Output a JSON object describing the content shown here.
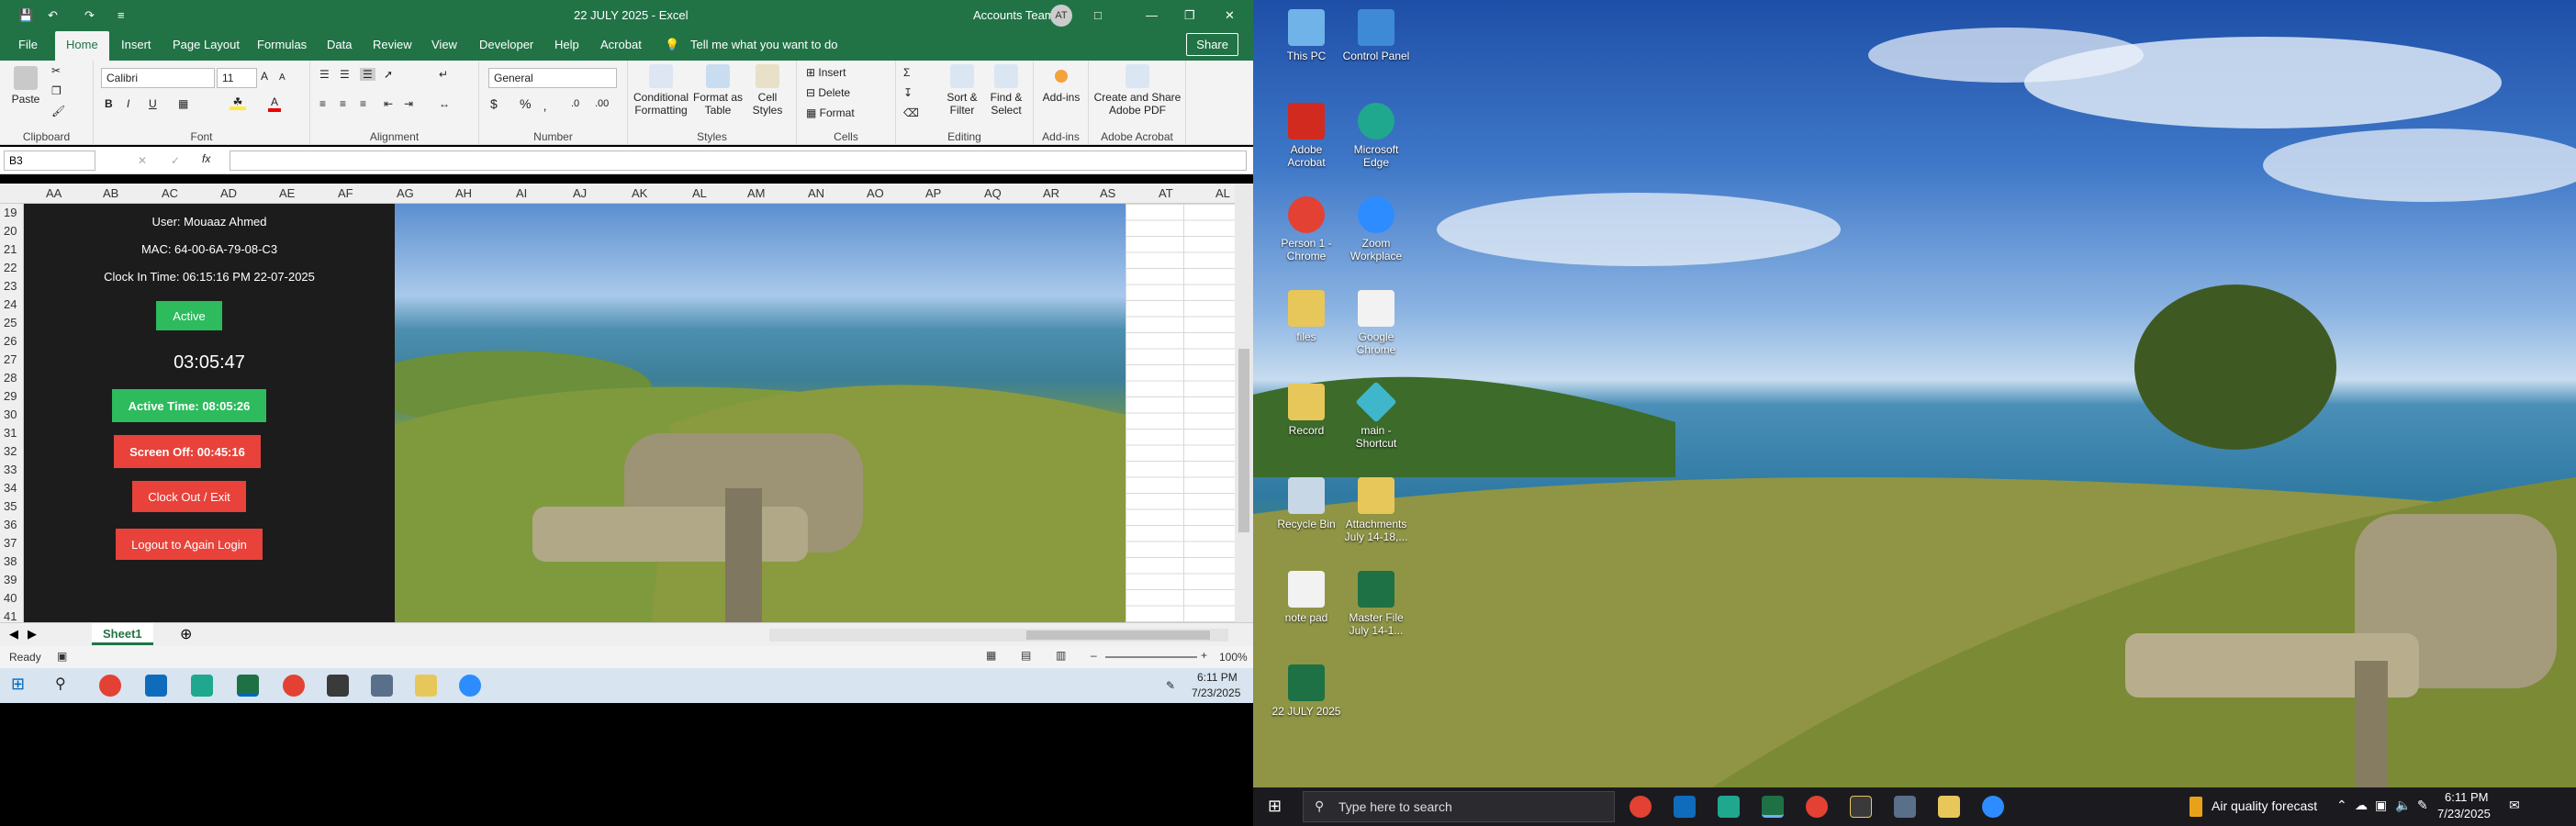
{
  "excel": {
    "titlebar": {
      "doc_title": "22 JULY 2025 - Excel",
      "account": "Accounts Team",
      "avatar": "AT"
    },
    "tabs": [
      "File",
      "Home",
      "Insert",
      "Page Layout",
      "Formulas",
      "Data",
      "Review",
      "View",
      "Developer",
      "Help",
      "Acrobat"
    ],
    "tell_me": "Tell me what you want to do",
    "share": "Share",
    "ribbon": {
      "clipboard": {
        "paste": "Paste",
        "label": "Clipboard"
      },
      "font": {
        "name": "Calibri",
        "size": "11",
        "label": "Font"
      },
      "alignment": {
        "label": "Alignment"
      },
      "number": {
        "format": "General",
        "label": "Number"
      },
      "styles": {
        "conditional": "Conditional Formatting",
        "format_table": "Format as Table",
        "cell_styles": "Cell Styles",
        "label": "Styles"
      },
      "cells": {
        "insert": "Insert",
        "delete": "Delete",
        "format": "Format",
        "label": "Cells"
      },
      "editing": {
        "sort": "Sort & Filter",
        "find": "Find & Select",
        "label": "Editing"
      },
      "addins": {
        "btn": "Add-ins",
        "label": "Add-ins"
      },
      "acrobat": {
        "btn": "Create and Share Adobe PDF",
        "label": "Adobe Acrobat"
      }
    },
    "name_box": "B3",
    "columns": [
      "AA",
      "AB",
      "AC",
      "AD",
      "AE",
      "AF",
      "AG",
      "AH",
      "AI",
      "AJ",
      "AK",
      "AL",
      "AM",
      "AN",
      "AO",
      "AP",
      "AQ",
      "AR",
      "AS",
      "AT",
      "AL"
    ],
    "rows": [
      "19",
      "20",
      "21",
      "22",
      "23",
      "24",
      "25",
      "26",
      "27",
      "28",
      "29",
      "30",
      "31",
      "32",
      "33",
      "34",
      "35",
      "36",
      "37",
      "38",
      "39",
      "40",
      "41"
    ],
    "panel": {
      "user": "User: Mouaaz Ahmed",
      "mac": "MAC: 64-00-6A-79-08-C3",
      "clock_in": "Clock In Time: 06:15:16 PM 22-07-2025",
      "status": "Active",
      "timer": "03:05:47",
      "active_time": "Active Time: 08:05:26",
      "screen_off": "Screen Off: 00:45:16",
      "clock_out": "Clock Out / Exit",
      "logout": "Logout to Again Login"
    },
    "sheet_tab": "Sheet1",
    "status": {
      "ready": "Ready",
      "zoom": "100%"
    },
    "taskbar_time": "6:11 PM",
    "taskbar_date": "7/23/2025"
  },
  "desktop": {
    "icons": [
      {
        "label": "This PC",
        "color": "#6fb3e8"
      },
      {
        "label": "Control Panel",
        "color": "#3e8ad6"
      },
      {
        "label": "Adobe Acrobat",
        "color": "#d22a1e"
      },
      {
        "label": "Microsoft Edge",
        "color": "#1fa88e"
      },
      {
        "label": "Person 1 - Chrome",
        "color": "#e34133"
      },
      {
        "label": "Zoom Workplace",
        "color": "#2d8cff"
      },
      {
        "label": "files",
        "color": "#e8c75a"
      },
      {
        "label": "Google Chrome",
        "color": "#f2f2f2"
      },
      {
        "label": "Record",
        "color": "#e8c75a"
      },
      {
        "label": "main - Shortcut",
        "color": "#3fb6c9"
      },
      {
        "label": "Recycle Bin",
        "color": "#c8d7e6"
      },
      {
        "label": "Attachments July 14-18,...",
        "color": "#e8c75a"
      },
      {
        "label": "note pad",
        "color": "#f2f2f2"
      },
      {
        "label": "Master File July 14-1...",
        "color": "#1e7145"
      },
      {
        "label": "22 JULY 2025",
        "color": "#1e7145"
      }
    ],
    "taskbar": {
      "search_placeholder": "Type here to search",
      "weather": "Air quality forecast",
      "time": "6:11 PM",
      "date": "7/23/2025"
    }
  },
  "colors": {
    "excel_green": "#217346",
    "active_green": "#2dbb5d",
    "red_button": "#e8423a"
  }
}
